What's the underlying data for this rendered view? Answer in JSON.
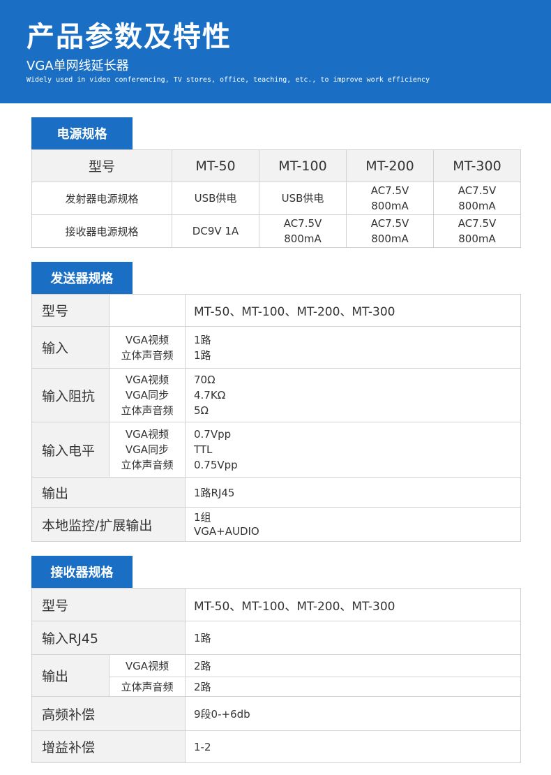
{
  "header": {
    "title": "产品参数及特性",
    "subtitle": "VGA单网线延长器",
    "tagline": "Widely used in video conferencing, TV stores, office, teaching, etc., to improve work efficiency",
    "bg_color": "#1a6fc4"
  },
  "power": {
    "tab": "电源规格",
    "model_label": "型号",
    "models": [
      "MT-50",
      "MT-100",
      "MT-200",
      "MT-300"
    ],
    "rows": [
      {
        "label": "发射器电源规格",
        "cells": [
          [
            "USB供电"
          ],
          [
            "USB供电"
          ],
          [
            "AC7.5V",
            "800mA"
          ],
          [
            "AC7.5V",
            "800mA"
          ]
        ]
      },
      {
        "label": "接收器电源规格",
        "cells": [
          [
            "DC9V 1A"
          ],
          [
            "AC7.5V",
            "800mA"
          ],
          [
            "AC7.5V",
            "800mA"
          ],
          [
            "AC7.5V",
            "800mA"
          ]
        ]
      }
    ]
  },
  "sender": {
    "tab": "发送器规格",
    "model_label": "型号",
    "model_value": "MT-50、MT-100、MT-200、MT-300",
    "input_label": "输入",
    "input_sub": [
      "VGA视频",
      "立体声音频"
    ],
    "input_val": [
      "1路",
      "1路"
    ],
    "impedance_label": "输入阻抗",
    "impedance_sub": [
      "VGA视频",
      "VGA同步",
      "立体声音频"
    ],
    "impedance_val": [
      "70Ω",
      "4.7KΩ",
      "5Ω"
    ],
    "level_label": "输入电平",
    "level_sub": [
      "VGA视频",
      "VGA同步",
      "立体声音频"
    ],
    "level_val": [
      "0.7Vpp",
      "TTL",
      "0.75Vpp"
    ],
    "output_label": "输出",
    "output_val": "1路RJ45",
    "local_label": "本地监控/扩展输出",
    "local_val": [
      "1组",
      "VGA+AUDIO"
    ]
  },
  "receiver": {
    "tab": "接收器规格",
    "model_label": "型号",
    "model_value": "MT-50、MT-100、MT-200、MT-300",
    "input_label": "输入RJ45",
    "input_val": "1路",
    "output_label": "输出",
    "output_sub": [
      "VGA视频",
      "立体声音频"
    ],
    "output_val": [
      "2路",
      "2路"
    ],
    "hf_label": "高频补偿",
    "hf_val": "9段0-+6db",
    "gain_label": "增益补偿",
    "gain_val": "1-2"
  }
}
